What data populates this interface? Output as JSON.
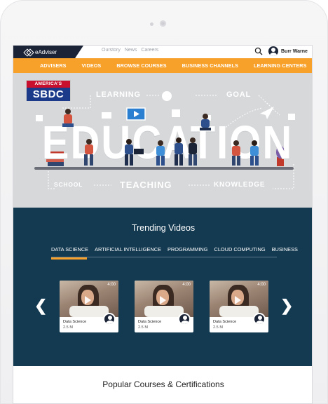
{
  "topbar": {
    "brand": "eAdviser",
    "links": [
      "Ourstory",
      "News",
      "Careers"
    ],
    "user_name": "Burr Warne",
    "icons": {
      "search": "search-icon",
      "user": "user-avatar-icon",
      "menu": "hamburger-menu-icon"
    }
  },
  "nav": {
    "items": [
      "ADVISERS",
      "VIDEOS",
      "BROWSE COURSES",
      "BUSINESS CHANNELS",
      "LEARNING CENTERS"
    ]
  },
  "hero": {
    "logo_top": "AMERICA'S",
    "logo_main": "SBDC",
    "headline": "EDUCATION",
    "words": {
      "learning": "LEARNING",
      "goal": "GOAL",
      "school": "SCHOOL",
      "teaching": "TEACHING",
      "knowledge": "KNOWLEDGE"
    }
  },
  "trending": {
    "title": "Trending Videos",
    "tabs": [
      "DATA SCIENCE",
      "ARTIFICIAL INTELLIGENCE",
      "PROGRAMMING",
      "CLOUD COMPUTING",
      "BUSINESS"
    ],
    "active_tab": "DATA SCIENCE",
    "prev_arrow": "❮",
    "next_arrow": "❯",
    "cards": [
      {
        "duration": "4:00",
        "category": "Data Science",
        "views": "2.5 M"
      },
      {
        "duration": "4:00",
        "category": "Data Science",
        "views": "2.5 M"
      },
      {
        "duration": "4:00",
        "category": "Data Science",
        "views": "2.5 M"
      }
    ]
  },
  "popular": {
    "title": "Popular Courses & Certifications"
  },
  "colors": {
    "accent": "#f7a12a",
    "brand_dark": "#1b2436",
    "trending_bg": "#143a52",
    "hero_bg": "#d7d8da"
  }
}
